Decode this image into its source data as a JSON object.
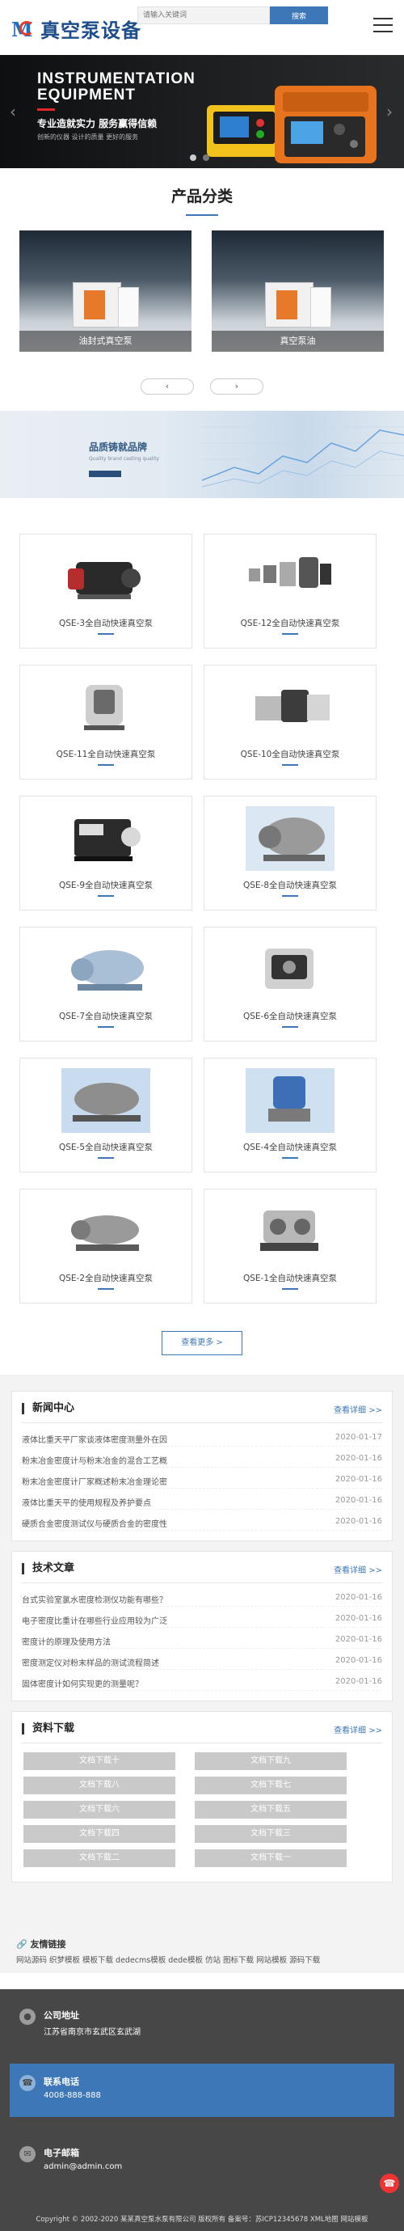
{
  "header": {
    "logo_text": "真空泵设备",
    "search_placeholder": "请输入关键词",
    "search_button": "搜索"
  },
  "banner": {
    "title": "INSTRUMENTATION EQUIPMENT",
    "slogan": "专业造就实力 服务赢得信赖",
    "subline": "创新的仪器 设计的质量 更好的服务"
  },
  "categories": {
    "title": "产品分类",
    "items": [
      {
        "label": "油封式真空泵"
      },
      {
        "label": "真空泵油"
      }
    ],
    "prev": "‹",
    "next": "›"
  },
  "brand": {
    "title": "品质铸就品牌",
    "subtitle": "Quality brand casting quality"
  },
  "products": {
    "items": [
      {
        "label": "QSE-3全自动快速真空泵"
      },
      {
        "label": "QSE-12全自动快速真空泵"
      },
      {
        "label": "QSE-11全自动快速真空泵"
      },
      {
        "label": "QSE-10全自动快速真空泵"
      },
      {
        "label": "QSE-9全自动快速真空泵"
      },
      {
        "label": "QSE-8全自动快速真空泵"
      },
      {
        "label": "QSE-7全自动快速真空泵"
      },
      {
        "label": "QSE-6全自动快速真空泵"
      },
      {
        "label": "QSE-5全自动快速真空泵"
      },
      {
        "label": "QSE-4全自动快速真空泵"
      },
      {
        "label": "QSE-2全自动快速真空泵"
      },
      {
        "label": "QSE-1全自动快速真空泵"
      }
    ],
    "more": "查看更多 >"
  },
  "news": {
    "title": "新闻中心",
    "more": "查看详细 >>",
    "items": [
      {
        "title": "液体比重天平厂家谈液体密度测量外在因",
        "date": "2020-01-17"
      },
      {
        "title": "粉末冶金密度计与粉末冶金的混合工艺概",
        "date": "2020-01-16"
      },
      {
        "title": "粉末冶金密度计厂家概述粉末冶金理论密",
        "date": "2020-01-16"
      },
      {
        "title": "液体比重天平的使用规程及养护要点",
        "date": "2020-01-16"
      },
      {
        "title": "硬质合金密度测试仪与硬质合金的密度性",
        "date": "2020-01-16"
      }
    ]
  },
  "articles": {
    "title": "技术文章",
    "more": "查看详细 >>",
    "items": [
      {
        "title": "台式实验室氯水密度检测仪功能有哪些？",
        "date": "2020-01-16"
      },
      {
        "title": "电子密度比重计在哪些行业应用较为广泛",
        "date": "2020-01-16"
      },
      {
        "title": "密度计的原理及使用方法",
        "date": "2020-01-16"
      },
      {
        "title": "密度测定仪对粉末样品的测试流程简述",
        "date": "2020-01-16"
      },
      {
        "title": "固体密度计如何实现更的测量呢？",
        "date": "2020-01-16"
      }
    ]
  },
  "downloads": {
    "title": "资料下载",
    "more": "查看详细 >>",
    "items": [
      "文档下载十",
      "文档下载九",
      "文档下载八",
      "文档下载七",
      "文档下载六",
      "文档下载五",
      "文档下载四",
      "文档下载三",
      "文档下载二",
      "文档下载一"
    ]
  },
  "links": {
    "title": "友情链接",
    "text": "网站源码 织梦模板 模板下载 dedecms模板 dede模板 仿站 图标下载 网站模板 源码下载"
  },
  "footer": {
    "address_title": "公司地址",
    "address": "江苏省南京市玄武区玄武湖",
    "phone_title": "联系电话",
    "phone": "4008-888-888",
    "email_title": "电子邮箱",
    "email": "admin@admin.com",
    "copyright": "Copyright © 2002-2020 某某真空泵水泵有限公司 版权所有 备案号：苏ICP12345678 XML地图 网站模板"
  }
}
